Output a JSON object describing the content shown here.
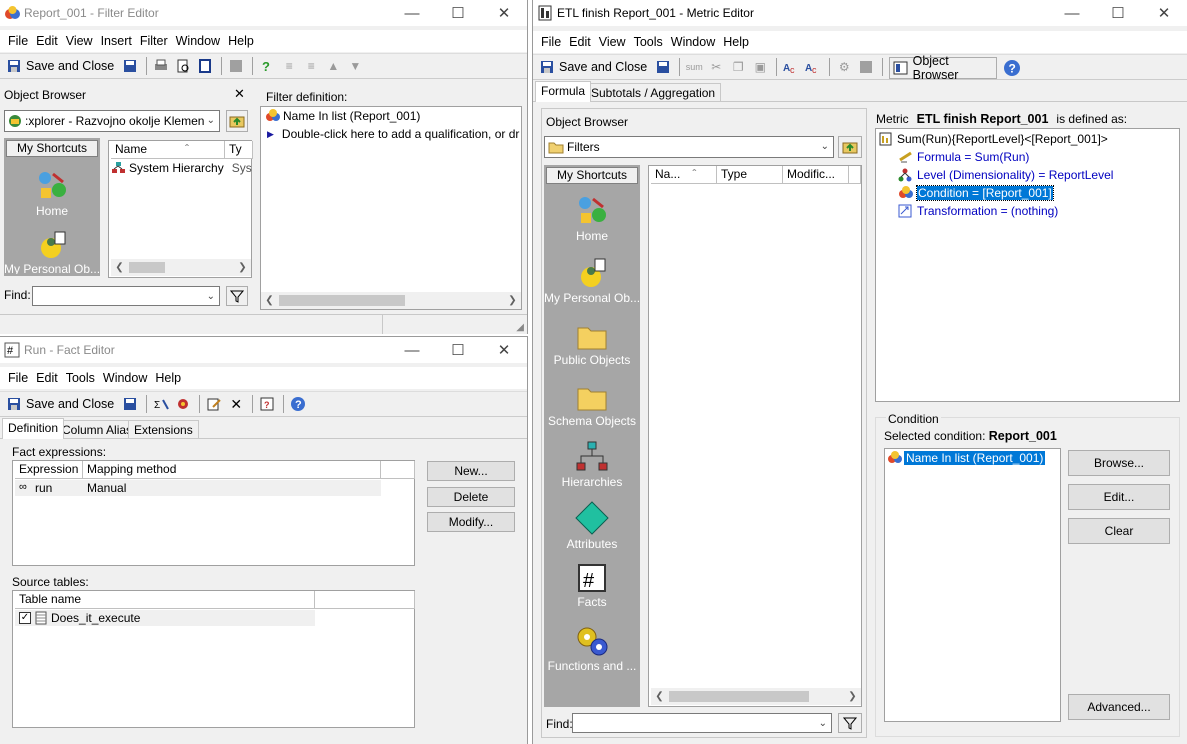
{
  "filter_editor": {
    "title": "Report_001 - Filter Editor",
    "menu": [
      "File",
      "Edit",
      "View",
      "Insert",
      "Filter",
      "Window",
      "Help"
    ],
    "save_close": "Save and Close",
    "object_browser_title": "Object Browser",
    "location_dropdown": ":xplorer - Razvojno okolje Klemen",
    "shortcuts_header": "My Shortcuts",
    "shortcuts": [
      "Home",
      "My Personal Ob..."
    ],
    "list_columns": [
      "Name",
      "Ty"
    ],
    "list_rows": [
      {
        "name": "System Hierarchy",
        "type": "Sys"
      }
    ],
    "find_label": "Find:",
    "filter_def_label": "Filter definition:",
    "filter_items": [
      "Name In list (Report_001)",
      "Double-click here to add a qualification, or dr"
    ]
  },
  "fact_editor": {
    "title": "Run - Fact Editor",
    "menu": [
      "File",
      "Edit",
      "Tools",
      "Window",
      "Help"
    ],
    "save_close": "Save and Close",
    "tabs": [
      "Definition",
      "Column Alias",
      "Extensions"
    ],
    "fact_expressions_label": "Fact expressions:",
    "expr_columns": [
      "Expression",
      "Mapping method"
    ],
    "expr_rows": [
      {
        "expression": "run",
        "mapping": "Manual"
      }
    ],
    "buttons": [
      "New...",
      "Delete",
      "Modify..."
    ],
    "source_tables_label": "Source tables:",
    "table_column": "Table name",
    "tables": [
      "Does_it_execute"
    ]
  },
  "metric_editor": {
    "title": "ETL finish Report_001 - Metric Editor",
    "menu": [
      "File",
      "Edit",
      "View",
      "Tools",
      "Window",
      "Help"
    ],
    "save_close": "Save and Close",
    "object_browser_btn": "Object Browser",
    "tabs": [
      "Formula",
      "Subtotals / Aggregation"
    ],
    "object_browser_title": "Object Browser",
    "folder_dropdown": "Filters",
    "shortcuts_header": "My Shortcuts",
    "shortcuts": [
      "Home",
      "My Personal Ob...",
      "Public Objects",
      "Schema Objects",
      "Hierarchies",
      "Attributes",
      "Facts",
      "Functions and ..."
    ],
    "list_columns": [
      "Na...",
      "Type",
      "Modific..."
    ],
    "find_label": "Find:",
    "metric_label": "Metric",
    "metric_name": "ETL finish Report_001",
    "defined_as": "is defined as:",
    "definition_root": "Sum(Run){ReportLevel}<[Report_001]>",
    "definition_items": [
      {
        "text": "Formula = Sum(Run)",
        "icon": "formula-icon"
      },
      {
        "text": "Level (Dimensionality) = ReportLevel",
        "icon": "level-icon"
      },
      {
        "text": "Condition = [Report_001]",
        "icon": "condition-icon"
      },
      {
        "text": "Transformation = (nothing)",
        "icon": "transformation-icon"
      }
    ],
    "condition_group": "Condition",
    "selected_condition_label": "Selected condition:",
    "selected_condition_value": "Report_001",
    "condition_item": "Name In list (Report_001)",
    "buttons": [
      "Browse...",
      "Edit...",
      "Clear",
      "Advanced..."
    ]
  }
}
